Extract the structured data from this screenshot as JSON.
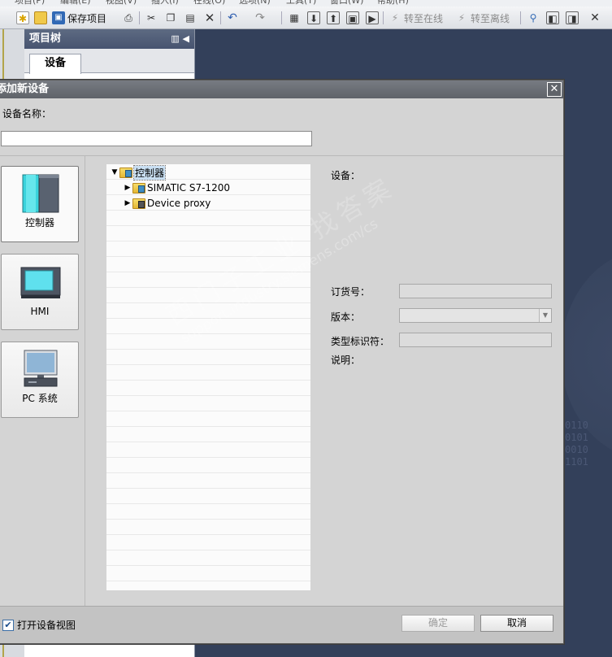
{
  "menubar": {
    "items": [
      "项目(P)",
      "编辑(E)",
      "视图(V)",
      "插入(I)",
      "在线(O)",
      "选项(N)",
      "工具(T)",
      "窗口(W)",
      "帮助(H)"
    ]
  },
  "toolbar": {
    "save_label": "保存项目",
    "go_online_label": "转至在线",
    "go_offline_label": "转至离线"
  },
  "project_tree": {
    "title": "项目树",
    "tab_label": "设备"
  },
  "dialog": {
    "title": "添加新设备",
    "device_name_label": "设备名称：",
    "device_name_value": "",
    "categories": [
      {
        "label": "控制器",
        "icon": "plc-icon",
        "selected": true
      },
      {
        "label": "HMI",
        "icon": "hmi-panel-icon",
        "selected": false
      },
      {
        "label": "PC 系统",
        "icon": "pc-system-icon",
        "selected": false
      }
    ],
    "tree": {
      "root_label": "控制器",
      "children": [
        "SIMATIC S7-1200",
        "Device proxy"
      ]
    },
    "details": {
      "device_label": "设备：",
      "order_no_label": "订货号：",
      "version_label": "版本：",
      "type_id_label": "类型标识符：",
      "description_label": "说明："
    },
    "footer": {
      "open_device_view_label": "打开设备视图",
      "open_device_view_checked": true,
      "ok_label": "确定",
      "cancel_label": "取消"
    }
  },
  "watermark": {
    "line1": "西门子工业",
    "line1b": "找答案",
    "line2": "support.industry.siemens.com/cs"
  },
  "colors": {
    "workspace_bg": "#33405a",
    "dialog_bg": "#d4d4d4",
    "title_bar": "#6a6e75",
    "accent_blue": "#3f8ec4"
  }
}
